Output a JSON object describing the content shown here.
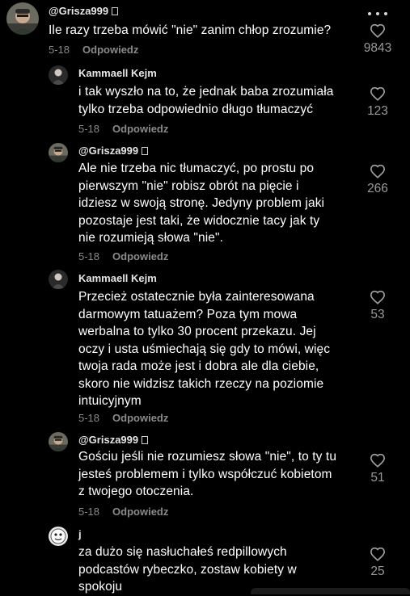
{
  "comments": [
    {
      "user": "@Grisza999",
      "text": "Ile razy trzeba mówić \"nie\" zanim chłop zrozumie?",
      "date": "5-18",
      "reply": "Odpowiedz",
      "likes": "9843",
      "avatar": "photo-avatar-man",
      "flag_icon": "flag-glyph-box"
    },
    {
      "user": "Kammaell Kejm",
      "text": "i tak wyszło na to, że jednak baba zrozumiała\ntylko trzeba odpowiednio długo tłumaczyć",
      "date": "5-18",
      "reply": "Odpowiedz",
      "likes": "123",
      "avatar": "photo-avatar-figure"
    },
    {
      "user": "@Grisza999",
      "text": "Ale nie trzeba nic tłumaczyć, po prostu po\npierwszym \"nie\" robisz obrót na pięcie i\nidziesz w swoją stronę. Jedyny problem jaki\npozostaje jest taki, że widocznie tacy jak ty\nnie rozumieją słowa \"nie\".",
      "date": "5-18",
      "reply": "Odpowiedz",
      "likes": "266",
      "avatar": "photo-avatar-man"
    },
    {
      "user": "Kammaell Kejm",
      "text": "Przecież ostatecznie była zainteresowana\ndarmowym tatuażem? Poza tym mowa\nwerbalna to tylko 30 procent przekazu. Jej\noczy i usta uśmiechają się gdy to mówi, więc\ntwoja rada może jest i dobra ale dla ciebie,\nskoro nie widzisz takich rzeczy na poziomie\nintuicyjnym",
      "date": "5-18",
      "reply": "Odpowiedz",
      "likes": "53",
      "avatar": "photo-avatar-figure"
    },
    {
      "user": "@Grisza999",
      "text": "Gościu jeśli nie rozumiesz słowa \"nie\", to ty tu\njesteś problemem i tylko współczuć kobietom\nz twojego otoczenia.",
      "date": "5-18",
      "reply": "Odpowiedz",
      "likes": "51",
      "avatar": "photo-avatar-man"
    },
    {
      "user": "j",
      "text": "za dużo się nasłuchałeś redpillowych\npodcastów rybeczko, zostaw kobiety w\nspokoju",
      "likes": "25",
      "avatar": "cartoon-avatar"
    }
  ],
  "icons": {
    "like": "heart-outline-icon",
    "more": "more-horizontal-icon"
  },
  "colors": {
    "background": "#000000",
    "text": "#ffffff",
    "muted": "#8a8a8a",
    "like_count": "#9a9a9a"
  }
}
